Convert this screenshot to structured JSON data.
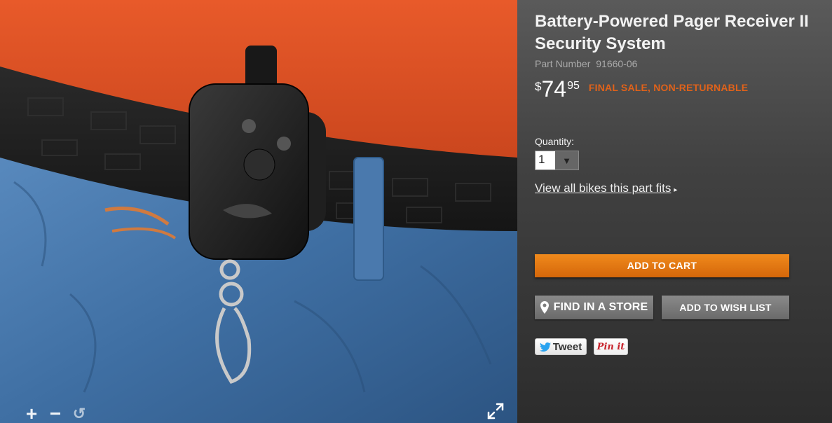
{
  "product": {
    "title": "Battery-Powered Pager Receiver II Security System",
    "part_number_label": "Part Number",
    "part_number": "91660-06",
    "price": {
      "currency": "$",
      "dollars": "74",
      "cents": "95"
    },
    "sale_note": "FINAL SALE, NON-RETURNABLE"
  },
  "quantity": {
    "label": "Quantity:",
    "value": "1",
    "arrow": "▼"
  },
  "links": {
    "view_bikes": "View all bikes this part fits",
    "view_bikes_arrow": "▸"
  },
  "buttons": {
    "add_to_cart": "ADD TO CART",
    "find_in_store": "FIND IN A STORE",
    "add_to_wishlist": "ADD TO WISH LIST"
  },
  "social": {
    "tweet": "Tweet",
    "pinit": "Pin it"
  },
  "image_controls": {
    "zoom_in": "+",
    "zoom_out": "−",
    "reset": "↺"
  },
  "colors": {
    "accent_orange": "#e0621a",
    "cart_button": "#e07a14",
    "panel_bg": "#3a3a3a"
  },
  "icons": [
    "map-pin-icon",
    "twitter-bird-icon",
    "fullscreen-icon",
    "zoom-in-icon",
    "zoom-out-icon",
    "reset-icon"
  ]
}
